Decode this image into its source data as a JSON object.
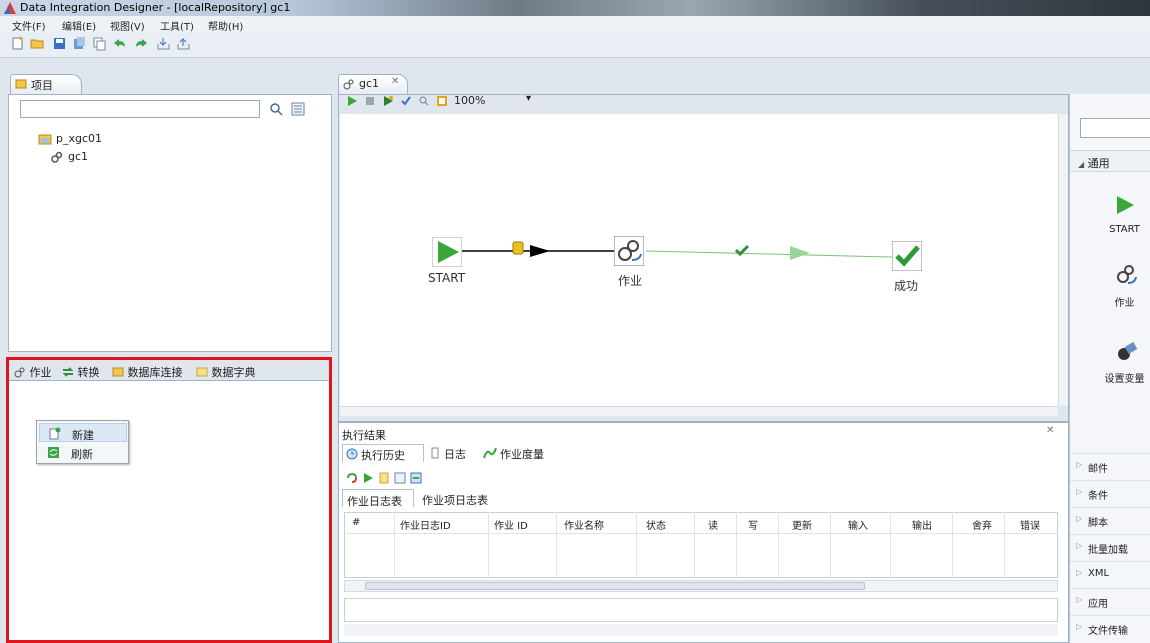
{
  "window": {
    "title": "Data Integration Designer - [localRepository] gc1"
  },
  "menu": [
    "文件(F)",
    "编辑(E)",
    "视图(V)",
    "工具(T)",
    "帮助(H)"
  ],
  "project_panel": {
    "tab": "项目",
    "search_value": "",
    "tree": [
      {
        "label": "p_xgc01",
        "icon": "project-folder-icon"
      },
      {
        "label": "gc1",
        "icon": "job-icon"
      }
    ]
  },
  "bottom_left": {
    "tabs": [
      "作业",
      "转换",
      "数据库连接",
      "数据字典"
    ],
    "context_menu": [
      "新建",
      "刷新"
    ]
  },
  "editor": {
    "tab": "gc1",
    "zoom": "100%",
    "nodes": [
      {
        "label": "START"
      },
      {
        "label": "作业"
      },
      {
        "label": "成功"
      }
    ]
  },
  "palette": {
    "search_value": "",
    "section": "通用",
    "items": [
      "START",
      "作业",
      "设置变量"
    ],
    "categories": [
      "邮件",
      "条件",
      "脚本",
      "批量加载",
      "XML",
      "应用",
      "文件传输"
    ]
  },
  "results": {
    "title": "执行结果",
    "tabs": [
      "执行历史",
      "日志",
      "作业度量"
    ],
    "subtabs": [
      "作业日志表",
      "作业项日志表"
    ],
    "columns": [
      "#",
      "作业日志ID",
      "作业 ID",
      "作业名称",
      "状态",
      "读",
      "写",
      "更新",
      "输入",
      "输出",
      "舍弃",
      "错误"
    ]
  }
}
